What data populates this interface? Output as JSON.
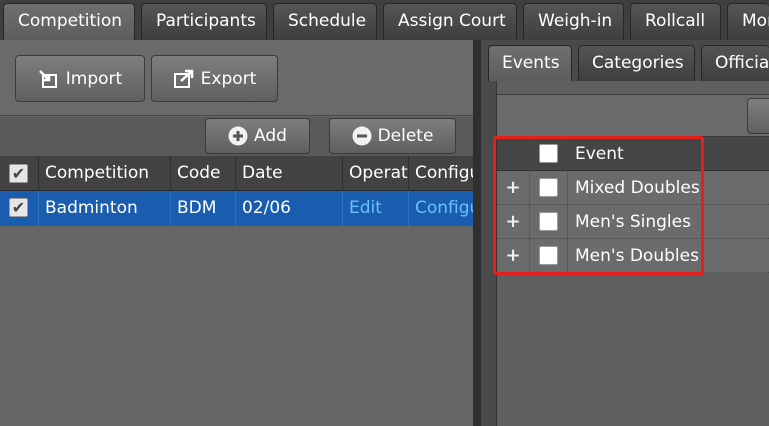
{
  "top_tabs": [
    {
      "label": "Competition",
      "active": true
    },
    {
      "label": "Participants",
      "active": false
    },
    {
      "label": "Schedule",
      "active": false
    },
    {
      "label": "Assign Court",
      "active": false
    },
    {
      "label": "Weigh-in",
      "active": false
    },
    {
      "label": "Rollcall",
      "active": false
    },
    {
      "label": "Mon",
      "active": false
    }
  ],
  "left_toolbar": {
    "import_label": "Import",
    "export_label": "Export",
    "add_label": "Add",
    "delete_label": "Delete"
  },
  "competition_grid": {
    "columns": [
      "Competition",
      "Code",
      "Date",
      "Operati",
      "Configu"
    ],
    "rows": [
      {
        "checked": true,
        "competition": "Badminton",
        "code": "BDM",
        "date": "02/06",
        "operation": "Edit",
        "configure": "Configu"
      }
    ]
  },
  "right_tabs": [
    {
      "label": "Events",
      "active": true
    },
    {
      "label": "Categories",
      "active": false
    },
    {
      "label": "Officia",
      "active": false
    }
  ],
  "events_grid": {
    "header": "Event",
    "expand_symbol": "+",
    "rows": [
      {
        "label": "Mixed Doubles",
        "checked": false
      },
      {
        "label": "Men's Singles",
        "checked": false
      },
      {
        "label": "Men's Doubles",
        "checked": false
      }
    ]
  },
  "colors": {
    "selected_row": "#1a5cae",
    "link": "#66c2ff",
    "highlight": "#e3201b"
  }
}
